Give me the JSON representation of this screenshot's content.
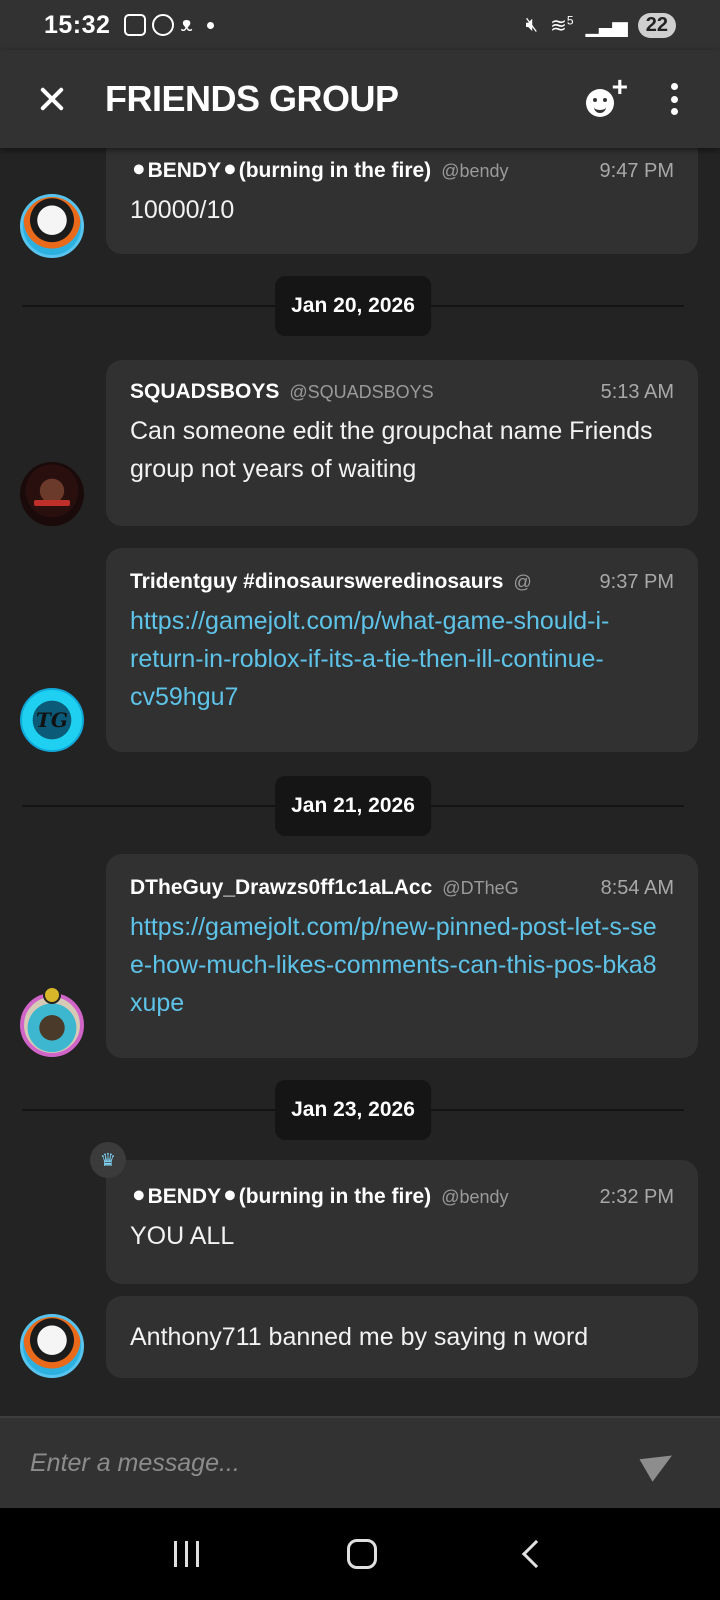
{
  "status_bar": {
    "time": "15:32",
    "battery": "22",
    "network_indicator": "5"
  },
  "header": {
    "title": "FRIENDS GROUP"
  },
  "dates": {
    "jan20": "Jan 20, 2026",
    "jan21": "Jan 21, 2026",
    "jan23": "Jan 23, 2026"
  },
  "messages": [
    {
      "author": "⚫BENDY⚫(burning in the fire)",
      "handle": "@bendy",
      "time": "9:47 PM",
      "text": "10000/10"
    },
    {
      "author": "SQUADSBOYS",
      "handle": "@SQUADSBOYS",
      "time": "5:13 AM",
      "text": "Can someone edit the groupchat name Friends group not years of waiting"
    },
    {
      "author": "Tridentguy #dinosaursweredinosaurs",
      "handle": "@",
      "time": "9:37 PM",
      "text": "https://gamejolt.com/p/what-game-should-i-return-in-roblox-if-its-a-tie-then-ill-continue-cv59hgu7"
    },
    {
      "author": "DTheGuy_Drawzs0ff1c1aLAcc",
      "handle": "@DTheG",
      "time": "8:54 AM",
      "text": "https://gamejolt.com/p/new-pinned-post-let-s-see-how-much-likes-comments-can-this-pos-bka8xupe"
    },
    {
      "author": "⚫BENDY⚫(burning in the fire)",
      "handle": "@bendy",
      "time": "2:32 PM",
      "text": "YOU ALL"
    },
    {
      "text": "Anthony711 banned me by saying n word"
    }
  ],
  "avatars": {
    "tridentguy_initials": "TG"
  },
  "input": {
    "placeholder": "Enter a message..."
  },
  "colors": {
    "background": "#232323",
    "bubble": "#313131",
    "link": "#5ec3e8",
    "header": "#323232"
  }
}
